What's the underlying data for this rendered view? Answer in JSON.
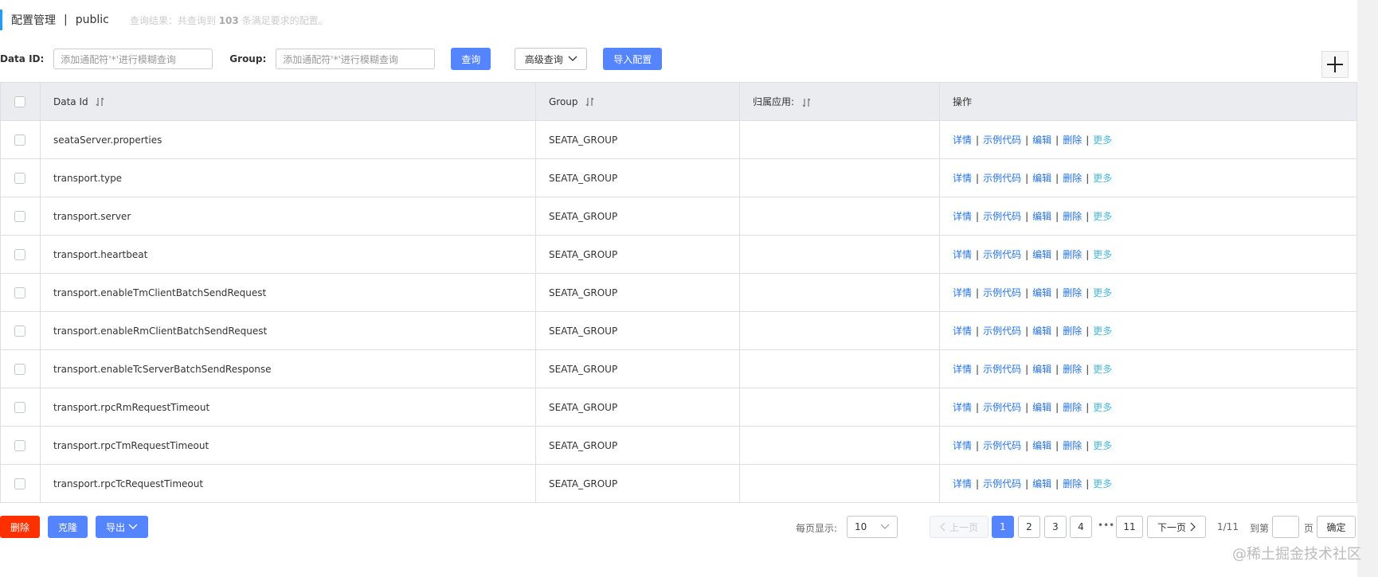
{
  "header": {
    "title": "配置管理",
    "separator": "|",
    "namespace": "public",
    "result_prefix": "查询结果：共查询到",
    "result_count": "103",
    "result_suffix": "条满足要求的配置。"
  },
  "search": {
    "data_id_label": "Data ID:",
    "data_id_placeholder": "添加通配符'*'进行模糊查询",
    "group_label": "Group:",
    "group_placeholder": "添加通配符'*'进行模糊查询",
    "query_button": "查询",
    "advanced_button": "高级查询",
    "import_button": "导入配置"
  },
  "table": {
    "columns": [
      "Data Id",
      "Group",
      "归属应用:",
      "操作"
    ],
    "rows": [
      {
        "data_id": "seataServer.properties",
        "group": "SEATA_GROUP",
        "app": ""
      },
      {
        "data_id": "transport.type",
        "group": "SEATA_GROUP",
        "app": ""
      },
      {
        "data_id": "transport.server",
        "group": "SEATA_GROUP",
        "app": ""
      },
      {
        "data_id": "transport.heartbeat",
        "group": "SEATA_GROUP",
        "app": ""
      },
      {
        "data_id": "transport.enableTmClientBatchSendRequest",
        "group": "SEATA_GROUP",
        "app": ""
      },
      {
        "data_id": "transport.enableRmClientBatchSendRequest",
        "group": "SEATA_GROUP",
        "app": ""
      },
      {
        "data_id": "transport.enableTcServerBatchSendResponse",
        "group": "SEATA_GROUP",
        "app": ""
      },
      {
        "data_id": "transport.rpcRmRequestTimeout",
        "group": "SEATA_GROUP",
        "app": ""
      },
      {
        "data_id": "transport.rpcTmRequestTimeout",
        "group": "SEATA_GROUP",
        "app": ""
      },
      {
        "data_id": "transport.rpcTcRequestTimeout",
        "group": "SEATA_GROUP",
        "app": ""
      }
    ],
    "ops": {
      "detail": "详情",
      "sample": "示例代码",
      "edit": "编辑",
      "delete": "删除",
      "more": "更多",
      "sep": "|"
    }
  },
  "footer": {
    "delete_button": "删除",
    "clone_button": "克隆",
    "export_button": "导出",
    "page_size_label": "每页显示:",
    "page_size_value": "10",
    "prev": "上一页",
    "pages": [
      "1",
      "2",
      "3",
      "4"
    ],
    "ellipsis": "•••",
    "last_page": "11",
    "next": "下一页",
    "page_info": "1/11",
    "goto_label": "到第",
    "goto_suffix": "页",
    "confirm": "确定"
  },
  "watermark": "@稀土掘金技术社区",
  "colors": {
    "primary": "#5584ff",
    "danger": "#ff3000",
    "link": "#2672e1",
    "more": "#4fb6d8",
    "accent": "#209bfa"
  }
}
